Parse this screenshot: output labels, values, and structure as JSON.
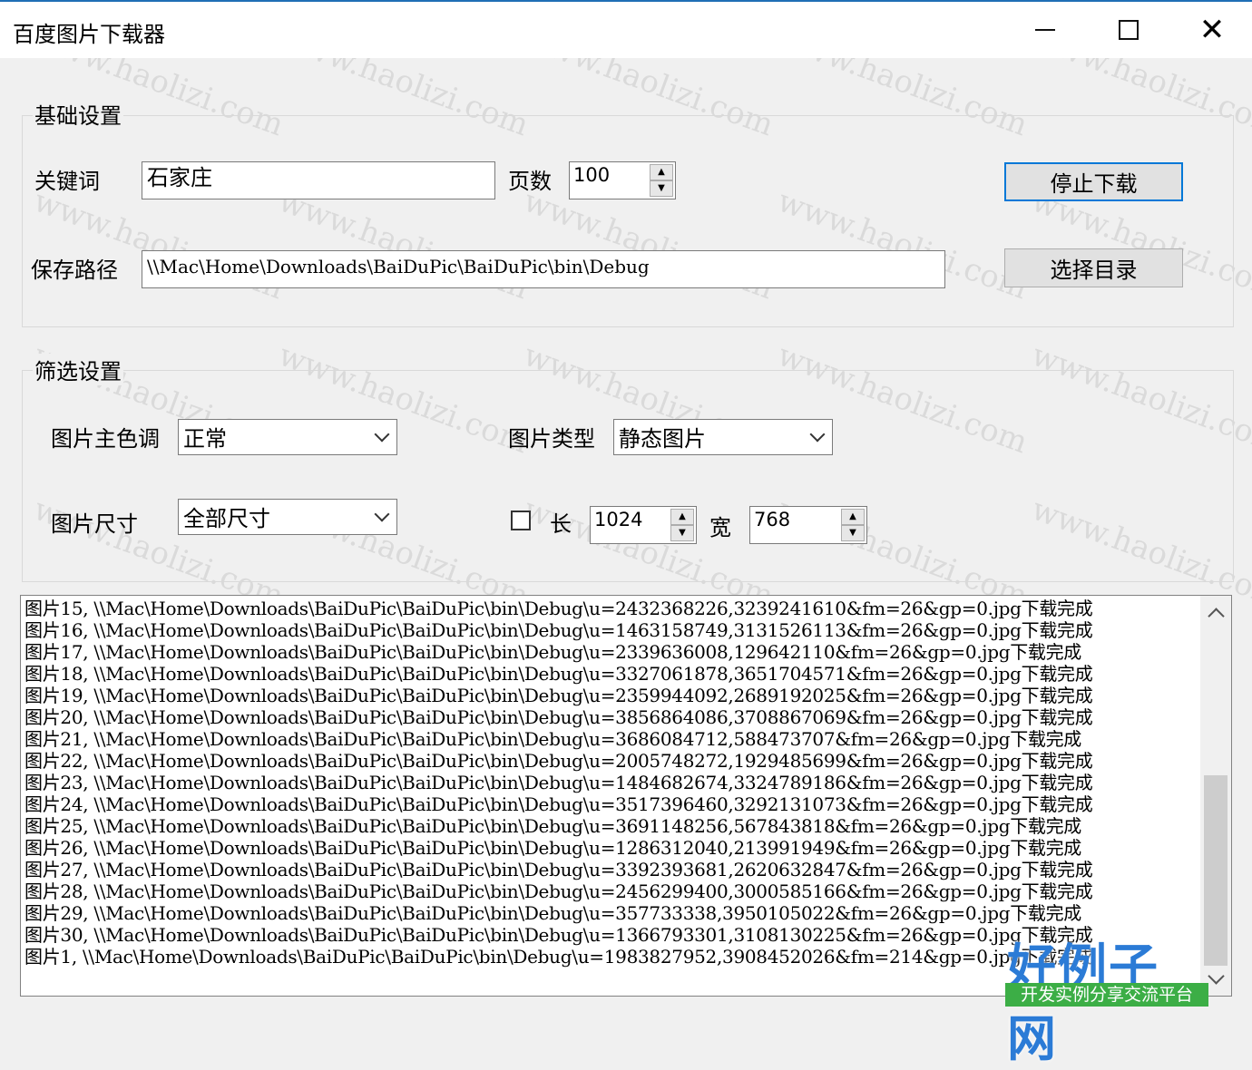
{
  "window": {
    "title": "百度图片下载器",
    "minimize_icon": "minimize-icon",
    "maximize_icon": "maximize-icon",
    "close_glyph": "✕"
  },
  "basic": {
    "group_label": "基础设置",
    "keyword_label": "关键词",
    "keyword_value": "石家庄",
    "pages_label": "页数",
    "pages_value": "100",
    "stop_button": "停止下载",
    "path_label": "保存路径",
    "path_value": "\\\\Mac\\Home\\Downloads\\BaiDuPic\\BaiDuPic\\bin\\Debug",
    "choose_dir_button": "选择目录"
  },
  "filter": {
    "group_label": "筛选设置",
    "color_label": "图片主色调",
    "color_value": "正常",
    "type_label": "图片类型",
    "type_value": "静态图片",
    "size_label": "图片尺寸",
    "size_value": "全部尺寸",
    "custom_size_checked": false,
    "length_label": "长",
    "length_value": "1024",
    "width_label": "宽",
    "width_value": "768"
  },
  "log": [
    "图片15, \\\\Mac\\Home\\Downloads\\BaiDuPic\\BaiDuPic\\bin\\Debug\\u=2432368226,3239241610&fm=26&gp=0.jpg下载完成",
    "图片16, \\\\Mac\\Home\\Downloads\\BaiDuPic\\BaiDuPic\\bin\\Debug\\u=1463158749,3131526113&fm=26&gp=0.jpg下载完成",
    "图片17, \\\\Mac\\Home\\Downloads\\BaiDuPic\\BaiDuPic\\bin\\Debug\\u=2339636008,129642110&fm=26&gp=0.jpg下载完成",
    "图片18, \\\\Mac\\Home\\Downloads\\BaiDuPic\\BaiDuPic\\bin\\Debug\\u=3327061878,3651704571&fm=26&gp=0.jpg下载完成",
    "图片19, \\\\Mac\\Home\\Downloads\\BaiDuPic\\BaiDuPic\\bin\\Debug\\u=2359944092,2689192025&fm=26&gp=0.jpg下载完成",
    "图片20, \\\\Mac\\Home\\Downloads\\BaiDuPic\\BaiDuPic\\bin\\Debug\\u=3856864086,3708867069&fm=26&gp=0.jpg下载完成",
    "图片21, \\\\Mac\\Home\\Downloads\\BaiDuPic\\BaiDuPic\\bin\\Debug\\u=3686084712,588473707&fm=26&gp=0.jpg下载完成",
    "图片22, \\\\Mac\\Home\\Downloads\\BaiDuPic\\BaiDuPic\\bin\\Debug\\u=2005748272,1929485699&fm=26&gp=0.jpg下载完成",
    "图片23, \\\\Mac\\Home\\Downloads\\BaiDuPic\\BaiDuPic\\bin\\Debug\\u=1484682674,3324789186&fm=26&gp=0.jpg下载完成",
    "图片24, \\\\Mac\\Home\\Downloads\\BaiDuPic\\BaiDuPic\\bin\\Debug\\u=3517396460,3292131073&fm=26&gp=0.jpg下载完成",
    "图片25, \\\\Mac\\Home\\Downloads\\BaiDuPic\\BaiDuPic\\bin\\Debug\\u=3691148256,567843818&fm=26&gp=0.jpg下载完成",
    "图片26, \\\\Mac\\Home\\Downloads\\BaiDuPic\\BaiDuPic\\bin\\Debug\\u=1286312040,213991949&fm=26&gp=0.jpg下载完成",
    "图片27, \\\\Mac\\Home\\Downloads\\BaiDuPic\\BaiDuPic\\bin\\Debug\\u=3392393681,2620632847&fm=26&gp=0.jpg下载完成",
    "图片28, \\\\Mac\\Home\\Downloads\\BaiDuPic\\BaiDuPic\\bin\\Debug\\u=2456299400,3000585166&fm=26&gp=0.jpg下载完成",
    "图片29, \\\\Mac\\Home\\Downloads\\BaiDuPic\\BaiDuPic\\bin\\Debug\\u=357733338,3950105022&fm=26&gp=0.jpg下载完成",
    "图片30, \\\\Mac\\Home\\Downloads\\BaiDuPic\\BaiDuPic\\bin\\Debug\\u=1366793301,3108130225&fm=26&gp=0.jpg下载完成",
    "图片1, \\\\Mac\\Home\\Downloads\\BaiDuPic\\BaiDuPic\\bin\\Debug\\u=1983827952,3908452026&fm=214&gp=0.jpg下载完成"
  ],
  "watermark_text": "www.haolizi.com",
  "brand": {
    "big": "好例子网",
    "small": "开发实例分享交流平台"
  },
  "colors": {
    "accent": "#0078d7",
    "brand_blue": "#2b7bd6",
    "brand_green": "#3cae46"
  }
}
